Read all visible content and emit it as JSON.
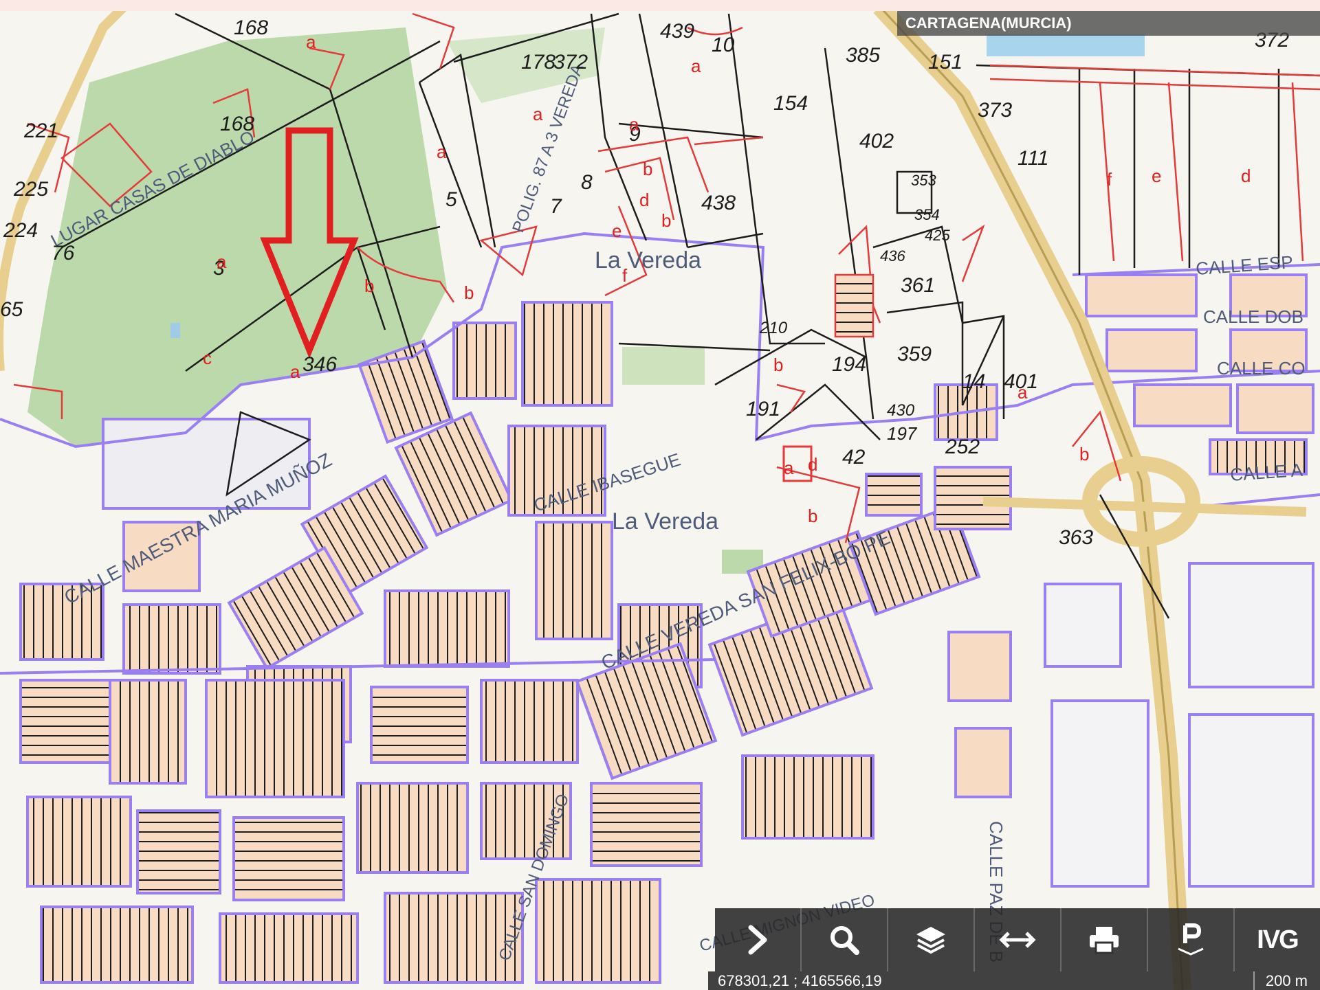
{
  "municipality": "CARTAGENA(MURCIA)",
  "places": {
    "north": "La Vereda",
    "south": "La Vereda"
  },
  "streets": [
    "LUGAR CASAS DE DIABLO",
    "POLIG. 87 A 3 VEREDA",
    "CALLE MAESTRA MARIA MUÑOZ",
    "CALLE VEREDA SAN FELIX-BO PE",
    "CALLE IBASEGUE",
    "CALLE ESP",
    "CALLE DOB",
    "CALLE CO",
    "CALLE A",
    "CALLE PAZ DE B",
    "CALLE SAN DOMINGO",
    "CALLE MIGNON VIDEO"
  ],
  "parcels": [
    "168",
    "221",
    "225",
    "224",
    "76",
    "65",
    "3",
    "346",
    "168",
    "5",
    "7",
    "9",
    "8",
    "178",
    "372",
    "439",
    "10",
    "154",
    "385",
    "402",
    "438",
    "151",
    "373",
    "111",
    "353",
    "354",
    "425",
    "436",
    "361",
    "359",
    "194",
    "14",
    "401",
    "191",
    "210",
    "430",
    "197",
    "252",
    "42",
    "363",
    "372"
  ],
  "subparcels": [
    "a",
    "b",
    "c",
    "d",
    "e",
    "f"
  ],
  "highlight": {
    "color": "#e02020",
    "target_parcel": "346"
  },
  "toolbar": {
    "buttons": [
      {
        "id": "expand",
        "icon": "chevron-right-icon"
      },
      {
        "id": "search",
        "icon": "search-icon"
      },
      {
        "id": "layers",
        "icon": "layers-icon"
      },
      {
        "id": "measure",
        "icon": "measure-arrows-icon"
      },
      {
        "id": "print",
        "icon": "print-icon"
      },
      {
        "id": "parking",
        "icon": "parking-icon"
      },
      {
        "id": "ivg",
        "label": "IVG"
      }
    ]
  },
  "status": {
    "coords": "678301,21 ; 4165566,19",
    "scale": "200 m"
  },
  "colors": {
    "urban_boundary": "#9a7ff0",
    "cadastral_line": "#1c1c1c",
    "rustic_subparcel": "#e33a3a",
    "highway": "#e8cf8f",
    "green_area": "#b9d8a8",
    "building": "#f6dcc4"
  }
}
